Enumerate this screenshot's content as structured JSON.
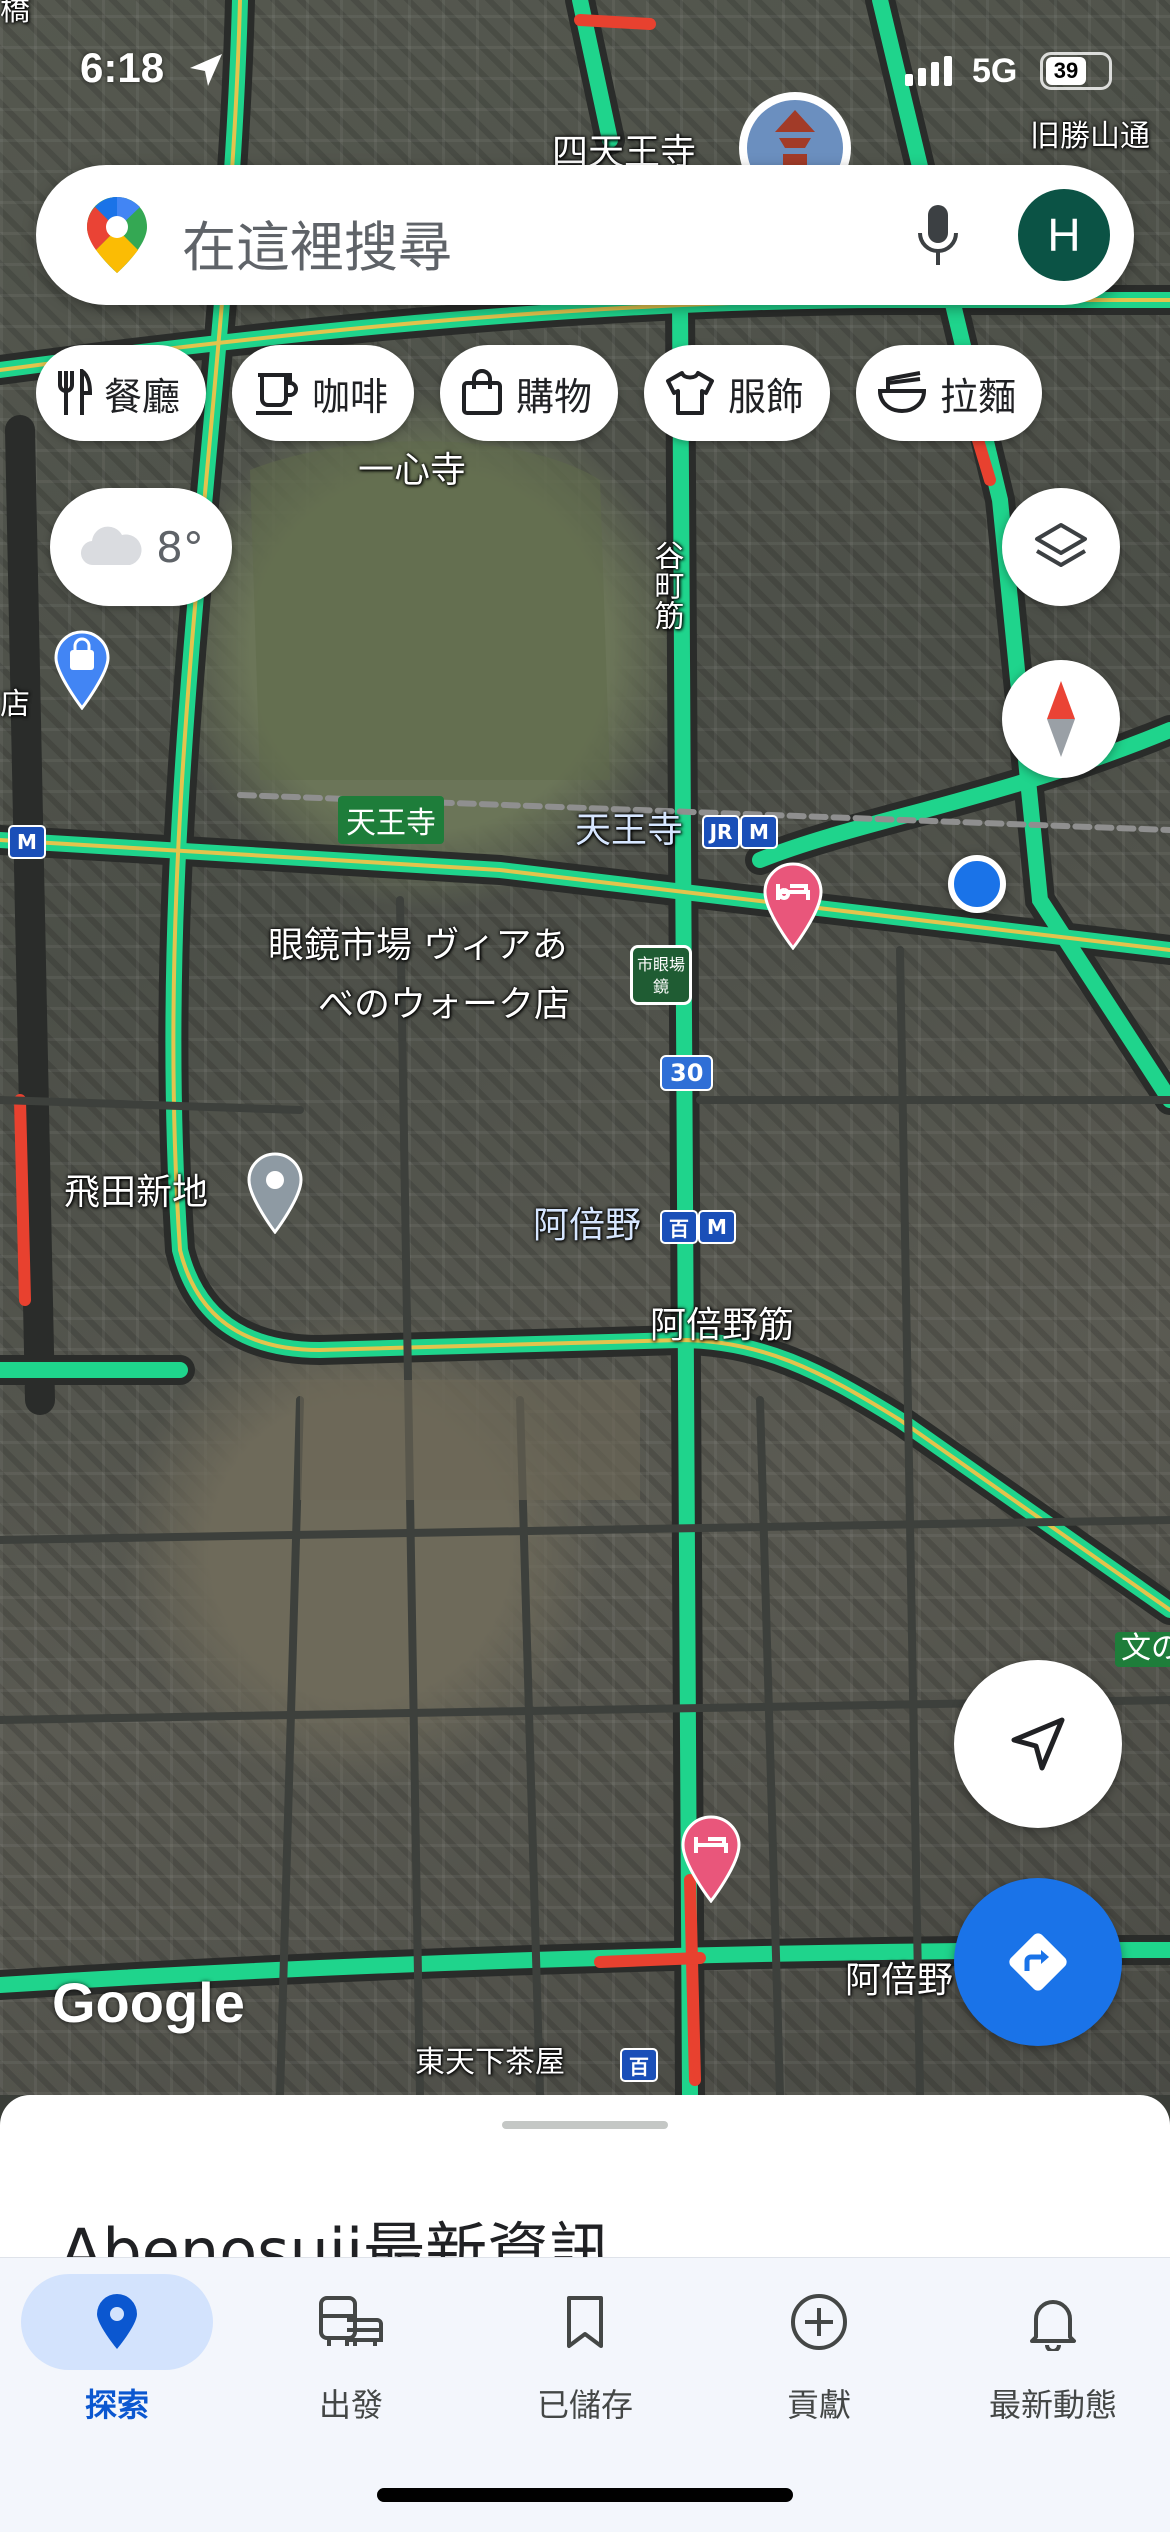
{
  "status_bar": {
    "time": "6:18",
    "network": "5G",
    "battery": "39"
  },
  "search": {
    "placeholder": "在這裡搜尋",
    "avatar_initial": "H"
  },
  "chips": [
    {
      "icon": "fork-knife-icon",
      "label": "餐廳"
    },
    {
      "icon": "coffee-icon",
      "label": "咖啡"
    },
    {
      "icon": "shopping-bag-icon",
      "label": "購物"
    },
    {
      "icon": "shirt-icon",
      "label": "服飾"
    },
    {
      "icon": "ramen-icon",
      "label": "拉麵"
    }
  ],
  "weather": {
    "temp": "8°",
    "icon": "cloud-icon"
  },
  "map": {
    "labels": {
      "shitennoji": "四天王寺",
      "hoshogatsuru": "旧勝山通",
      "isshinji": "一心寺",
      "tanimachi": "谷町筋",
      "tennoji_park": "天王寺",
      "tennoji_station": "天王寺",
      "megane_line1": "眼鏡市場 ヴィアあ",
      "megane_line2": "べのウォーク店",
      "megane_tag": "市眼場鏡",
      "route30": "30",
      "tobita": "飛田新地",
      "abeno": "阿倍野",
      "abenosuji": "阿倍野筋",
      "abeno_bottom": "阿倍野",
      "higashi_tengachaya": "東天下茶屋",
      "bunnosato": "文の",
      "jr": "JR",
      "metro": "M",
      "tram": "百",
      "store_left": "店",
      "bridge": "橋"
    },
    "attribution": "Google"
  },
  "sheet": {
    "title": "Abenosuji最新資訊"
  },
  "bottom_nav": [
    {
      "label": "探索",
      "icon": "location-pin-icon",
      "active": true
    },
    {
      "label": "出發",
      "icon": "commute-icon",
      "active": false
    },
    {
      "label": "已儲存",
      "icon": "bookmark-icon",
      "active": false
    },
    {
      "label": "貢獻",
      "icon": "add-circle-icon",
      "active": false
    },
    {
      "label": "最新動態",
      "icon": "bell-icon",
      "active": false
    }
  ],
  "colors": {
    "accent": "#1a73e8",
    "traffic_green": "#1fd48c",
    "nav_active": "#0b57d0",
    "hotel_pin": "#e9567b"
  }
}
